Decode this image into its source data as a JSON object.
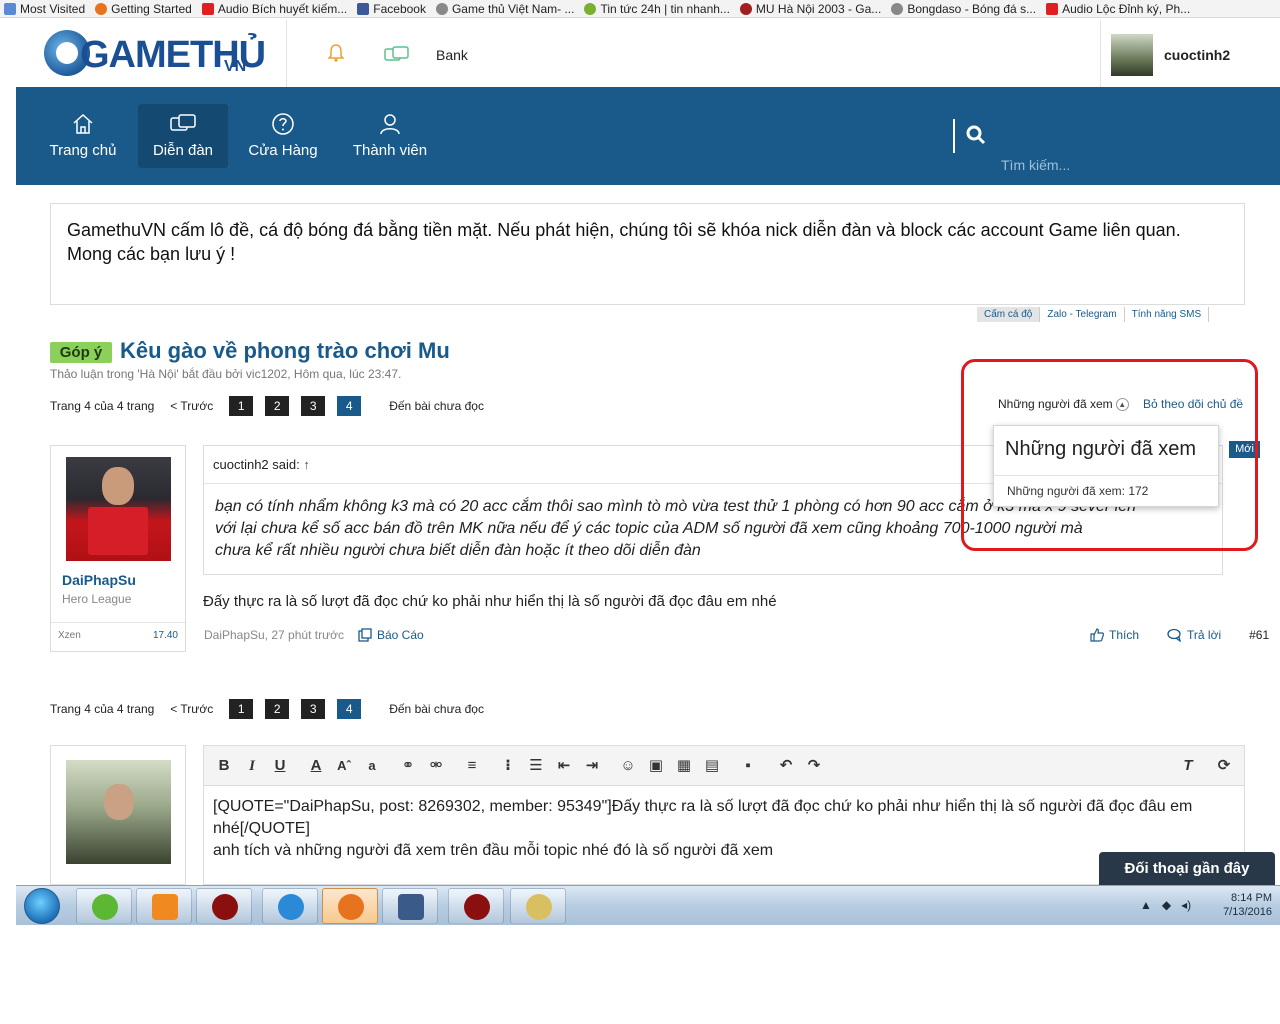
{
  "bookmarks": [
    {
      "label": "Most Visited",
      "color": "#5a8ad6"
    },
    {
      "label": "Getting Started",
      "color": "#e8731e"
    },
    {
      "label": "Audio Bích huyết kiếm...",
      "color": "#e02020"
    },
    {
      "label": "Facebook",
      "color": "#3b5998"
    },
    {
      "label": "Game thủ Việt Nam- ...",
      "color": "#888888"
    },
    {
      "label": "Tin tức 24h | tin nhanh...",
      "color": "#7ab030"
    },
    {
      "label": "MU Hà Nội 2003 - Ga...",
      "color": "#a02020"
    },
    {
      "label": "Bongdaso - Bóng đá s...",
      "color": "#888888"
    },
    {
      "label": "Audio Lộc Đỉnh ký, Ph...",
      "color": "#e02020"
    }
  ],
  "header": {
    "logo_text": "GAMETHỦ",
    "logo_suffix": "VN",
    "bank": "Bank",
    "username": "cuoctinh2"
  },
  "nav": {
    "items": [
      {
        "label": "Trang chủ",
        "icon": "home-icon"
      },
      {
        "label": "Diễn đàn",
        "icon": "forum-icon"
      },
      {
        "label": "Cửa Hàng",
        "icon": "help-icon"
      },
      {
        "label": "Thành viên",
        "icon": "user-icon"
      }
    ],
    "search_placeholder": "Tìm kiếm..."
  },
  "notice": {
    "text": "GamethuVN cấm lô đề, cá độ bóng đá bằng tiền mặt. Nếu phát hiện, chúng tôi sẽ khóa nick diễn đàn và block các account Game liên quan. Mong các bạn lưu ý !",
    "tabs": [
      "Cấm cá độ",
      "Zalo - Telegram",
      "Tính năng SMS"
    ]
  },
  "thread": {
    "tag": "Góp ý",
    "title": "Kêu gào về phong trào chơi Mu",
    "meta": "Thảo luận trong 'Hà Nội' bắt đầu bởi vic1202, Hôm qua, lúc 23:47."
  },
  "pager": {
    "label": "Trang 4 của 4 trang",
    "prev": "< Trước",
    "pages": [
      "1",
      "2",
      "3",
      "4"
    ],
    "unread": "Đến bài chưa đọc"
  },
  "watchers": {
    "label": "Những người đã xem",
    "unfollow": "Bỏ theo dõi chủ đề",
    "popup_title": "Những người đã xem",
    "popup_count": "Những người đã xem: 172",
    "new_badge": "Mới"
  },
  "post": {
    "author": "DaiPhapSu",
    "user_title": "Hero League",
    "currency_label": "Xzen",
    "currency_value": "17.40",
    "quote_author": "cuoctinh2 said:",
    "quote_arrow": "↑",
    "quote_lines": [
      "bạn có tính nhẩm không k3 mà có 20 acc cắm thôi sao mình tò mò vừa test thử 1 phòng có hơn 90 acc cắm ở k3 mà x 9 sever lên",
      "với lại chưa kể số acc bán đồ trên MK nữa nếu để ý các topic của ADM số người đã xem cũng khoảng 700-1000 người mà",
      "chưa kể rất nhiều người chưa biết diễn đàn hoặc ít theo dõi diễn đàn"
    ],
    "message": "Đấy thực ra là số lượt đã đọc chứ ko phải như hiển thị là số người đã đọc đâu em nhé",
    "meta": "DaiPhapSu, 27 phút trước",
    "report": "Báo Cáo",
    "like": "Thích",
    "reply": "Trả lời",
    "number": "#61"
  },
  "editor": {
    "line1": "[QUOTE=\"DaiPhapSu, post: 8269302, member: 95349\"]Đấy thực ra là số lượt đã đọc chứ ko phải như hiển thị là số người đã đọc đâu em",
    "line2": "nhé[/QUOTE]",
    "line3": "anh tích và những người đã xem trên đầu mỗi topic nhé đó là số người đã xem"
  },
  "recent": "Đối thoại gần đây",
  "taskbar": {
    "time": "8:14 PM",
    "date": "7/13/2016"
  }
}
